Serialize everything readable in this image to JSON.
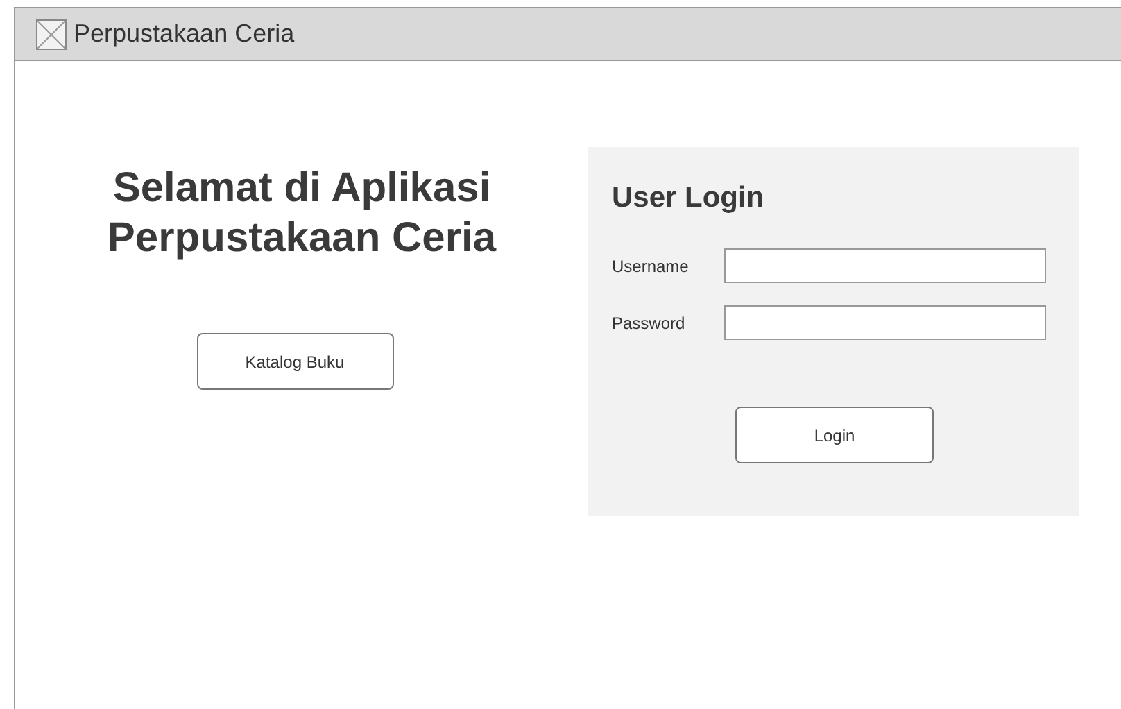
{
  "window": {
    "title": "Perpustakaan Ceria"
  },
  "welcome": {
    "heading": "Selamat di Aplikasi Perpustakaan Ceria",
    "button": "Katalog Buku"
  },
  "login": {
    "heading": "User Login",
    "fields": [
      {
        "label": "Username"
      },
      {
        "label": "Password"
      }
    ],
    "button": "Login"
  }
}
